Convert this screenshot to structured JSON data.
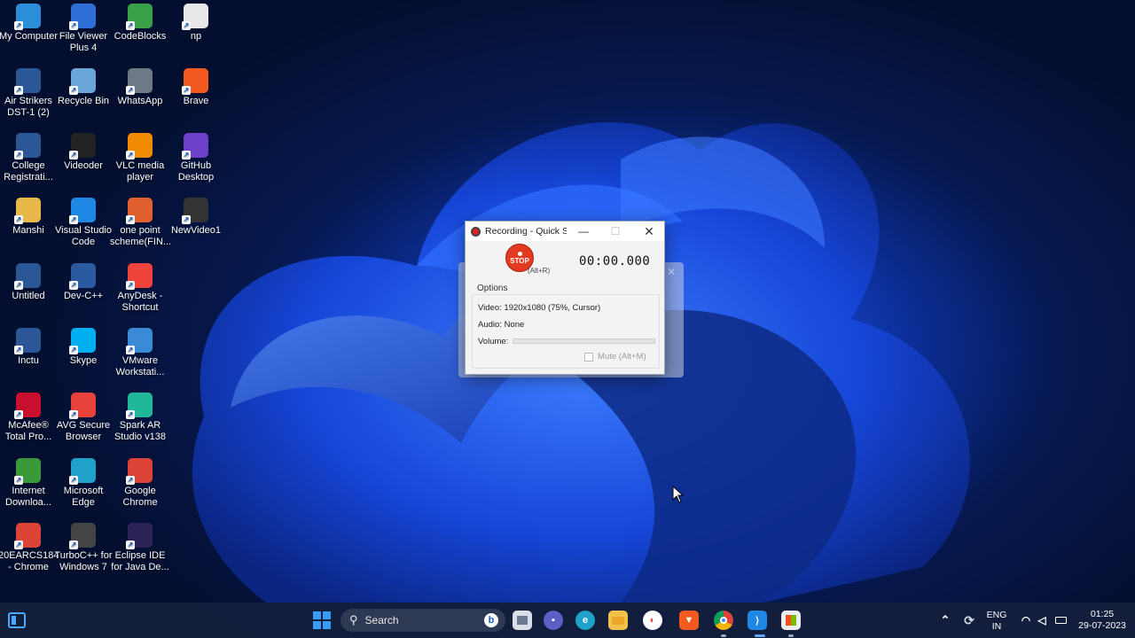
{
  "desktop_icons": [
    {
      "label": "My Computer",
      "icon": "computer-icon",
      "color": "#2a8fd8"
    },
    {
      "label": "Air Strikers DST-1 (2)",
      "icon": "word-doc-icon",
      "color": "#2b5797"
    },
    {
      "label": "College Registrati...",
      "icon": "word-doc-icon",
      "color": "#2b5797"
    },
    {
      "label": "Manshi",
      "icon": "folder-icon",
      "color": "#e8b84a"
    },
    {
      "label": "Untitled",
      "icon": "word-doc-icon",
      "color": "#2b5797"
    },
    {
      "label": "Inctu",
      "icon": "word-doc-icon",
      "color": "#2b5797"
    },
    {
      "label": "McAfee® Total Pro...",
      "icon": "mcafee-icon",
      "color": "#c8102e"
    },
    {
      "label": "Internet Downloa...",
      "icon": "idm-icon",
      "color": "#3a9a3a"
    },
    {
      "label": "20EARCS184 - Chrome",
      "icon": "chrome-icon",
      "color": "#db4437"
    },
    {
      "label": "File Viewer Plus 4",
      "icon": "file-viewer-icon",
      "color": "#2d6fd6"
    },
    {
      "label": "Recycle Bin",
      "icon": "recycle-bin-icon",
      "color": "#6aa6d8"
    },
    {
      "label": "Videoder",
      "icon": "videoder-icon",
      "color": "#222222"
    },
    {
      "label": "Visual Studio Code",
      "icon": "vscode-icon",
      "color": "#1f88e5"
    },
    {
      "label": "Dev-C++",
      "icon": "devcpp-icon",
      "color": "#2c5aa0"
    },
    {
      "label": "Skype",
      "icon": "skype-icon",
      "color": "#00aff0"
    },
    {
      "label": "AVG Secure Browser",
      "icon": "avg-icon",
      "color": "#e8423c"
    },
    {
      "label": "Microsoft Edge",
      "icon": "edge-icon",
      "color": "#1fa1c9"
    },
    {
      "label": "TurboC++ for Windows 7",
      "icon": "turboc-icon",
      "color": "#444444"
    },
    {
      "label": "CodeBlocks",
      "icon": "codeblocks-icon",
      "color": "#3aa04a"
    },
    {
      "label": "WhatsApp",
      "icon": "whatsapp-icon",
      "color": "#6d7a86"
    },
    {
      "label": "VLC media player",
      "icon": "vlc-icon",
      "color": "#f08a00"
    },
    {
      "label": "one point scheme(FIN...",
      "icon": "pdf-icon",
      "color": "#e06030"
    },
    {
      "label": "AnyDesk - Shortcut",
      "icon": "anydesk-icon",
      "color": "#ef443b"
    },
    {
      "label": "VMware Workstati...",
      "icon": "vmware-icon",
      "color": "#3a8ad8"
    },
    {
      "label": "Spark AR Studio v138",
      "icon": "sparkar-icon",
      "color": "#20b89a"
    },
    {
      "label": "Google Chrome",
      "icon": "chrome-icon",
      "color": "#db4437"
    },
    {
      "label": "Eclipse IDE for Java De...",
      "icon": "eclipse-icon",
      "color": "#2c2255"
    },
    {
      "label": "np",
      "icon": "cpp-file-icon",
      "color": "#e8e8e8"
    },
    {
      "label": "Brave",
      "icon": "brave-icon",
      "color": "#f25a1f"
    },
    {
      "label": "GitHub Desktop",
      "icon": "github-desktop-icon",
      "color": "#6e40c9"
    },
    {
      "label": "NewVideo1",
      "icon": "video-file-icon",
      "color": "#333333"
    }
  ],
  "recorder": {
    "title": "Recording - Quick S...",
    "stop_label": "STOP",
    "stop_hotkey": "(Alt+R)",
    "timer": "00:00.000",
    "options_header": "Options",
    "video": "Video: 1920x1080 (75%, Cursor)",
    "audio": "Audio: None",
    "volume_label": "Volume:",
    "mute_label": "Mute (Alt+M)"
  },
  "taskbar": {
    "search_placeholder": "Search",
    "language_line1": "ENG",
    "language_line2": "IN",
    "time": "01:25",
    "date": "29-07-2023"
  }
}
